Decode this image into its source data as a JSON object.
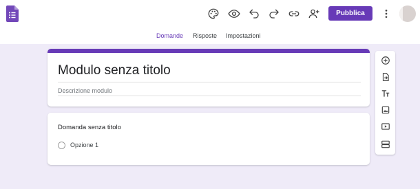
{
  "header": {
    "logo_icon": "forms-logo-icon",
    "toolbar_icons": [
      "palette-icon",
      "eye-icon",
      "undo-icon",
      "redo-icon",
      "link-icon",
      "person-add-icon"
    ],
    "publish_label": "Pubblica",
    "more_icon": "more-vert-icon",
    "avatar_icon": "avatar"
  },
  "tabs": [
    {
      "label": "Domande",
      "active": true
    },
    {
      "label": "Risposte",
      "active": false
    },
    {
      "label": "Impostazioni",
      "active": false
    }
  ],
  "form": {
    "title": "Modulo senza titolo",
    "description_placeholder": "Descrizione modulo"
  },
  "question": {
    "title": "Domanda senza titolo",
    "options": [
      {
        "label": "Opzione 1"
      }
    ]
  },
  "side_toolbar": [
    "add-question-icon",
    "import-questions-icon",
    "title-text-icon",
    "image-icon",
    "video-icon",
    "section-icon"
  ],
  "colors": {
    "accent": "#673ab7",
    "background": "#efebf8"
  }
}
